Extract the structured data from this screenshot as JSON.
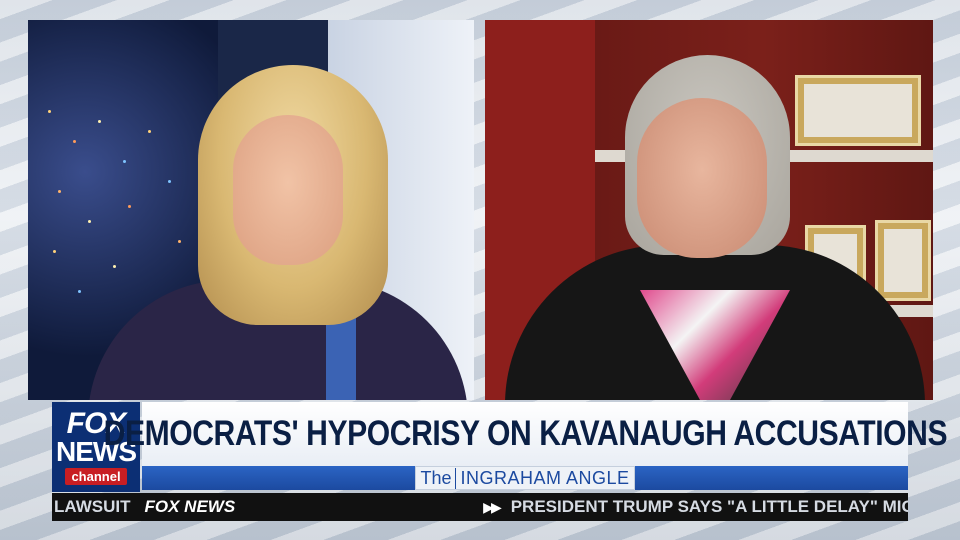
{
  "network": {
    "logo_top": "FOX",
    "logo_middle": "NEWS",
    "logo_bottom": "channel"
  },
  "headline": {
    "text": "DEMOCRATS' HYPOCRISY ON KAVANAUGH ACCUSATIONS"
  },
  "show": {
    "prefix": "The",
    "name": "INGRAHAM ANGLE"
  },
  "ticker": {
    "left_text": "LAWSUIT",
    "brand": "FOX NEWS",
    "arrows": "▶▶",
    "scroll_text": "PRESIDENT TRUMP SAYS \"A LITTLE DELAY\" MIGHT"
  },
  "colors": {
    "navy": "#0c2f74",
    "headline_text": "#0a1f44",
    "show_bar": "#1c4aa0",
    "channel_red": "#c81e23"
  }
}
